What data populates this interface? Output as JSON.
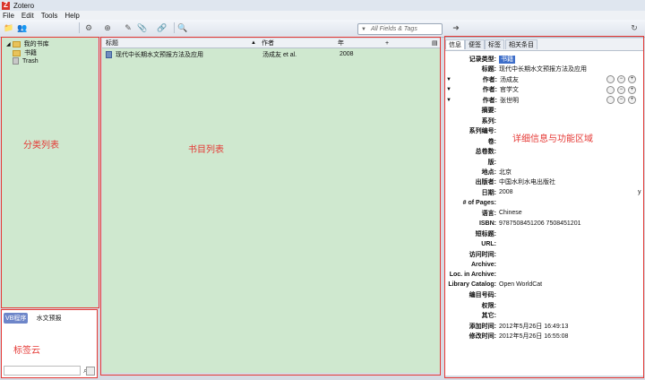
{
  "window": {
    "title": "Zotero",
    "logo_letter": "Z"
  },
  "menu": [
    "File",
    "Edit",
    "Tools",
    "Help"
  ],
  "toolbar": {
    "search_placeholder": "All Fields & Tags",
    "icons": [
      "new-collection-icon",
      "new-group-icon",
      "actions-gear-icon",
      "new-item-icon",
      "new-note-icon",
      "attachment-icon",
      "link-icon",
      "advanced-search-icon",
      "locate-icon",
      "sync-icon"
    ]
  },
  "collections": {
    "library_name": "我的书库",
    "items": [
      "书籍",
      "Trash"
    ]
  },
  "annotations": {
    "collections": "分类列表",
    "items": "书目列表",
    "details": "详细信息与功能区域",
    "tags": "标签云"
  },
  "items_table": {
    "columns": [
      "标题",
      "作者",
      "年",
      "+"
    ],
    "rows": [
      {
        "title": "现代中长期水文预报方法及应用",
        "creator": "汤成友 et al.",
        "year": "2008"
      }
    ]
  },
  "details": {
    "tabs": [
      "信息",
      "便签",
      "标签",
      "相关条目"
    ],
    "fields": [
      {
        "label": "记录类型:",
        "value": "书籍",
        "selected": true
      },
      {
        "label": "标题:",
        "value": "现代中长期水文预报方法及应用"
      },
      {
        "label": "作者:",
        "value": "汤成友",
        "creator": true
      },
      {
        "label": "作者:",
        "value": "官学文",
        "creator": true
      },
      {
        "label": "作者:",
        "value": "张世明",
        "creator": true
      },
      {
        "label": "摘要:",
        "value": ""
      },
      {
        "label": "系列:",
        "value": ""
      },
      {
        "label": "系列编号:",
        "value": ""
      },
      {
        "label": "卷:",
        "value": ""
      },
      {
        "label": "总卷数:",
        "value": ""
      },
      {
        "label": "版:",
        "value": ""
      },
      {
        "label": "地点:",
        "value": "北京"
      },
      {
        "label": "出版者:",
        "value": "中国水利水电出版社"
      },
      {
        "label": "日期:",
        "value": "2008"
      },
      {
        "label": "# of Pages:",
        "value": ""
      },
      {
        "label": "语言:",
        "value": "Chinese"
      },
      {
        "label": "ISBN:",
        "value": "9787508451206 7508451201"
      },
      {
        "label": "短标题:",
        "value": ""
      },
      {
        "label": "URL:",
        "value": ""
      },
      {
        "label": "访问时间:",
        "value": ""
      },
      {
        "label": "Archive:",
        "value": ""
      },
      {
        "label": "Loc. in Archive:",
        "value": ""
      },
      {
        "label": "Library Catalog:",
        "value": "Open WorldCat"
      },
      {
        "label": "编目号码:",
        "value": ""
      },
      {
        "label": "权限:",
        "value": ""
      },
      {
        "label": "其它:",
        "value": ""
      },
      {
        "label": "添加时间:",
        "value": "2012年5月26日 16:49:13"
      },
      {
        "label": "修改时间:",
        "value": "2012年5月26日 16:55:08"
      }
    ],
    "date_side_text": "y"
  },
  "tags": [
    {
      "label": "VB程序",
      "selected": true
    },
    {
      "label": "水文预报",
      "selected": false
    }
  ],
  "colors": {
    "panel_green": "#cfe8cf",
    "frame_red": "#e53935",
    "selected_blue": "#3d6ec9"
  }
}
